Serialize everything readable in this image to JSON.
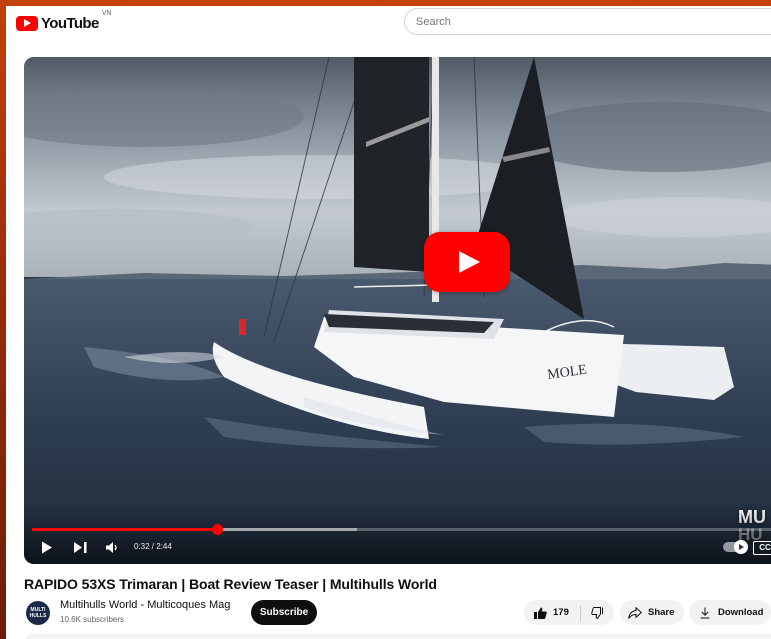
{
  "header": {
    "brand": "YouTube",
    "country_code": "VN",
    "logo_icon": "youtube-play-logo",
    "search_placeholder": "Search"
  },
  "player": {
    "current_time": "0:32",
    "duration": "2:44",
    "time_display": "0:32 / 2:44",
    "progress_fraction": 0.248,
    "buffered_fraction": 0.437,
    "watermark_line1": "MU",
    "watermark_line2": "HU",
    "captions_label": "CC",
    "controls": {
      "play_icon": "play-icon",
      "next_icon": "next-icon",
      "volume_icon": "volume-icon",
      "autoplay_icon": "autoplay-toggle",
      "captions_icon": "captions-icon"
    },
    "scene_text": "MOLE",
    "colors": {
      "progress": "#ff0000",
      "big_play": "#ff0000"
    }
  },
  "video": {
    "title": "RAPIDO 53XS Trimaran | Boat Review Teaser | Multihulls World"
  },
  "channel": {
    "name": "Multihulls World - Multicoques Mag",
    "subscribers": "10.6K subscribers",
    "avatar_line1": "MULTI",
    "avatar_line2": "HULLS",
    "subscribe_label": "Subscribe"
  },
  "actions": {
    "like_count": "179",
    "share_label": "Share",
    "download_label": "Download"
  }
}
